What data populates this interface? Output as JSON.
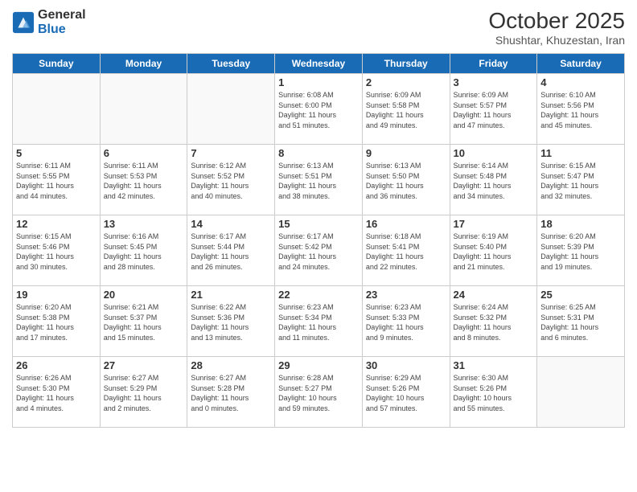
{
  "header": {
    "logo_general": "General",
    "logo_blue": "Blue",
    "month_title": "October 2025",
    "location": "Shushtar, Khuzestan, Iran"
  },
  "days_of_week": [
    "Sunday",
    "Monday",
    "Tuesday",
    "Wednesday",
    "Thursday",
    "Friday",
    "Saturday"
  ],
  "weeks": [
    [
      {
        "day": "",
        "info": ""
      },
      {
        "day": "",
        "info": ""
      },
      {
        "day": "",
        "info": ""
      },
      {
        "day": "1",
        "info": "Sunrise: 6:08 AM\nSunset: 6:00 PM\nDaylight: 11 hours\nand 51 minutes."
      },
      {
        "day": "2",
        "info": "Sunrise: 6:09 AM\nSunset: 5:58 PM\nDaylight: 11 hours\nand 49 minutes."
      },
      {
        "day": "3",
        "info": "Sunrise: 6:09 AM\nSunset: 5:57 PM\nDaylight: 11 hours\nand 47 minutes."
      },
      {
        "day": "4",
        "info": "Sunrise: 6:10 AM\nSunset: 5:56 PM\nDaylight: 11 hours\nand 45 minutes."
      }
    ],
    [
      {
        "day": "5",
        "info": "Sunrise: 6:11 AM\nSunset: 5:55 PM\nDaylight: 11 hours\nand 44 minutes."
      },
      {
        "day": "6",
        "info": "Sunrise: 6:11 AM\nSunset: 5:53 PM\nDaylight: 11 hours\nand 42 minutes."
      },
      {
        "day": "7",
        "info": "Sunrise: 6:12 AM\nSunset: 5:52 PM\nDaylight: 11 hours\nand 40 minutes."
      },
      {
        "day": "8",
        "info": "Sunrise: 6:13 AM\nSunset: 5:51 PM\nDaylight: 11 hours\nand 38 minutes."
      },
      {
        "day": "9",
        "info": "Sunrise: 6:13 AM\nSunset: 5:50 PM\nDaylight: 11 hours\nand 36 minutes."
      },
      {
        "day": "10",
        "info": "Sunrise: 6:14 AM\nSunset: 5:48 PM\nDaylight: 11 hours\nand 34 minutes."
      },
      {
        "day": "11",
        "info": "Sunrise: 6:15 AM\nSunset: 5:47 PM\nDaylight: 11 hours\nand 32 minutes."
      }
    ],
    [
      {
        "day": "12",
        "info": "Sunrise: 6:15 AM\nSunset: 5:46 PM\nDaylight: 11 hours\nand 30 minutes."
      },
      {
        "day": "13",
        "info": "Sunrise: 6:16 AM\nSunset: 5:45 PM\nDaylight: 11 hours\nand 28 minutes."
      },
      {
        "day": "14",
        "info": "Sunrise: 6:17 AM\nSunset: 5:44 PM\nDaylight: 11 hours\nand 26 minutes."
      },
      {
        "day": "15",
        "info": "Sunrise: 6:17 AM\nSunset: 5:42 PM\nDaylight: 11 hours\nand 24 minutes."
      },
      {
        "day": "16",
        "info": "Sunrise: 6:18 AM\nSunset: 5:41 PM\nDaylight: 11 hours\nand 22 minutes."
      },
      {
        "day": "17",
        "info": "Sunrise: 6:19 AM\nSunset: 5:40 PM\nDaylight: 11 hours\nand 21 minutes."
      },
      {
        "day": "18",
        "info": "Sunrise: 6:20 AM\nSunset: 5:39 PM\nDaylight: 11 hours\nand 19 minutes."
      }
    ],
    [
      {
        "day": "19",
        "info": "Sunrise: 6:20 AM\nSunset: 5:38 PM\nDaylight: 11 hours\nand 17 minutes."
      },
      {
        "day": "20",
        "info": "Sunrise: 6:21 AM\nSunset: 5:37 PM\nDaylight: 11 hours\nand 15 minutes."
      },
      {
        "day": "21",
        "info": "Sunrise: 6:22 AM\nSunset: 5:36 PM\nDaylight: 11 hours\nand 13 minutes."
      },
      {
        "day": "22",
        "info": "Sunrise: 6:23 AM\nSunset: 5:34 PM\nDaylight: 11 hours\nand 11 minutes."
      },
      {
        "day": "23",
        "info": "Sunrise: 6:23 AM\nSunset: 5:33 PM\nDaylight: 11 hours\nand 9 minutes."
      },
      {
        "day": "24",
        "info": "Sunrise: 6:24 AM\nSunset: 5:32 PM\nDaylight: 11 hours\nand 8 minutes."
      },
      {
        "day": "25",
        "info": "Sunrise: 6:25 AM\nSunset: 5:31 PM\nDaylight: 11 hours\nand 6 minutes."
      }
    ],
    [
      {
        "day": "26",
        "info": "Sunrise: 6:26 AM\nSunset: 5:30 PM\nDaylight: 11 hours\nand 4 minutes."
      },
      {
        "day": "27",
        "info": "Sunrise: 6:27 AM\nSunset: 5:29 PM\nDaylight: 11 hours\nand 2 minutes."
      },
      {
        "day": "28",
        "info": "Sunrise: 6:27 AM\nSunset: 5:28 PM\nDaylight: 11 hours\nand 0 minutes."
      },
      {
        "day": "29",
        "info": "Sunrise: 6:28 AM\nSunset: 5:27 PM\nDaylight: 10 hours\nand 59 minutes."
      },
      {
        "day": "30",
        "info": "Sunrise: 6:29 AM\nSunset: 5:26 PM\nDaylight: 10 hours\nand 57 minutes."
      },
      {
        "day": "31",
        "info": "Sunrise: 6:30 AM\nSunset: 5:26 PM\nDaylight: 10 hours\nand 55 minutes."
      },
      {
        "day": "",
        "info": ""
      }
    ]
  ]
}
